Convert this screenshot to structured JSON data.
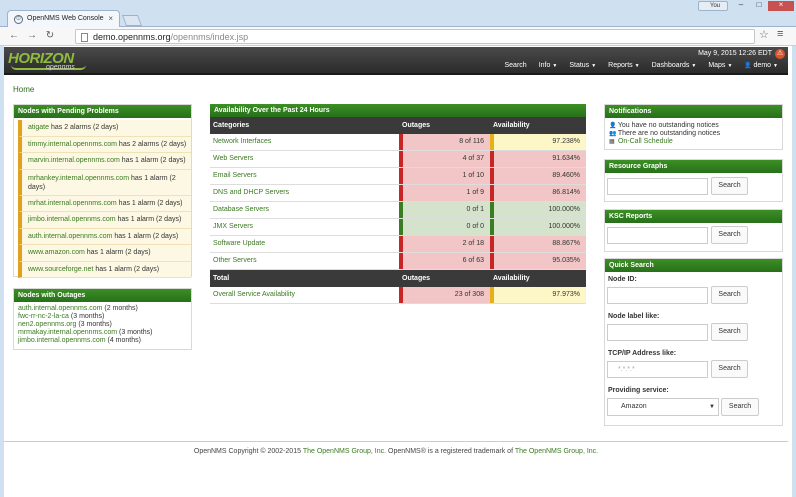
{
  "browser": {
    "tab_title": "OpenNMS Web Console",
    "user_badge": "You",
    "url_host": "demo.opennms.org",
    "url_path": "/opennms/index.jsp"
  },
  "header": {
    "logo_main": "HORIZON",
    "logo_sub": "opennms",
    "datetime": "May 9, 2015 12:26 EDT",
    "nav": [
      {
        "label": "Search",
        "dropdown": false
      },
      {
        "label": "Info",
        "dropdown": true
      },
      {
        "label": "Status",
        "dropdown": true
      },
      {
        "label": "Reports",
        "dropdown": true
      },
      {
        "label": "Dashboards",
        "dropdown": true
      },
      {
        "label": "Maps",
        "dropdown": true
      },
      {
        "label": "demo",
        "dropdown": true
      }
    ]
  },
  "breadcrumb": {
    "home": "Home"
  },
  "pending": {
    "title": "Nodes with Pending Problems",
    "items": [
      {
        "node": "atigate",
        "text": "has 2 alarms (2 days)"
      },
      {
        "node": "timmy.internal.opennms.com",
        "text": "has 2 alarms (2 days)"
      },
      {
        "node": "marvin.internal.opennms.com",
        "text": "has 1 alarm (2 days)"
      },
      {
        "node": "mrhankey.internal.opennms.com",
        "text": "has 1 alarm (2 days)"
      },
      {
        "node": "mrhat.internal.opennms.com",
        "text": "has 1 alarm (2 days)"
      },
      {
        "node": "jimbo.internal.opennms.com",
        "text": "has 1 alarm (2 days)"
      },
      {
        "node": "auth.internal.opennms.com",
        "text": "has 1 alarm (2 days)"
      },
      {
        "node": "www.amazon.com",
        "text": "has 1 alarm (2 days)"
      },
      {
        "node": "www.sourceforge.net",
        "text": "has 1 alarm (2 days)"
      }
    ]
  },
  "outages": {
    "title": "Nodes with Outages",
    "items": [
      {
        "node": "auth.internal.opennms.com",
        "dur": "(2 months)"
      },
      {
        "node": "fwc-rr-nc-2-la-ca",
        "dur": "(3 months)"
      },
      {
        "node": "nen2.opennms.org",
        "dur": "(3 months)"
      },
      {
        "node": "mrmakay.internal.opennms.com",
        "dur": "(3 months)"
      },
      {
        "node": "jimbo.internal.opennms.com",
        "dur": "(4 months)"
      }
    ]
  },
  "availability": {
    "title": "Availability Over the Past 24 Hours",
    "headers": {
      "categories": "Categories",
      "outages": "Outages",
      "availability": "Availability"
    },
    "rows": [
      {
        "cat": "Network Interfaces",
        "out": "8 of 116",
        "av": "97.238%",
        "out_status": "red",
        "av_status": "yel"
      },
      {
        "cat": "Web Servers",
        "out": "4 of 37",
        "av": "91.634%",
        "out_status": "red",
        "av_status": "red"
      },
      {
        "cat": "Email Servers",
        "out": "1 of 10",
        "av": "89.460%",
        "out_status": "red",
        "av_status": "red"
      },
      {
        "cat": "DNS and DHCP Servers",
        "out": "1 of 9",
        "av": "86.814%",
        "out_status": "red",
        "av_status": "red"
      },
      {
        "cat": "Database Servers",
        "out": "0 of 1",
        "av": "100.000%",
        "out_status": "grn",
        "av_status": "grn"
      },
      {
        "cat": "JMX Servers",
        "out": "0 of 0",
        "av": "100.000%",
        "out_status": "grn",
        "av_status": "grn"
      },
      {
        "cat": "Software Update",
        "out": "2 of 18",
        "av": "88.867%",
        "out_status": "red",
        "av_status": "red"
      },
      {
        "cat": "Other Servers",
        "out": "6 of 63",
        "av": "95.035%",
        "out_status": "red",
        "av_status": "red"
      }
    ],
    "total_headers": {
      "total": "Total",
      "outages": "Outages",
      "availability": "Availability"
    },
    "total_row": {
      "cat": "Overall Service Availability",
      "out": "23 of 308",
      "av": "97.973%",
      "out_status": "red",
      "av_status": "yel"
    }
  },
  "notifications": {
    "title": "Notifications",
    "items": [
      {
        "icon": "user-icon",
        "text": "You have no outstanding notices"
      },
      {
        "icon": "users-icon",
        "text": "There are no outstanding notices"
      },
      {
        "icon": "calendar-icon",
        "text": "On-Call Schedule"
      }
    ]
  },
  "resource_graphs": {
    "title": "Resource Graphs",
    "button": "Search"
  },
  "ksc_reports": {
    "title": "KSC Reports",
    "button": "Search"
  },
  "quick_search": {
    "title": "Quick Search",
    "node_id_label": "Node ID:",
    "node_label_label": "Node label like:",
    "ip_label": "TCP/IP Address like:",
    "ip_placeholder": "*.*.*.*",
    "service_label": "Providing service:",
    "service_value": "Amazon",
    "button": "Search"
  },
  "footer": {
    "prefix": "OpenNMS Copyright © 2002-2015",
    "link1": "The OpenNMS Group, Inc.",
    "middle": "OpenNMS® is a registered trademark of",
    "link2": "The OpenNMS Group, Inc."
  },
  "colors": {
    "brand_green": "#2f7d1e",
    "alert_red": "#c62626",
    "warn_yellow": "#e6b118",
    "pending_bg": "#fcf8e3"
  }
}
